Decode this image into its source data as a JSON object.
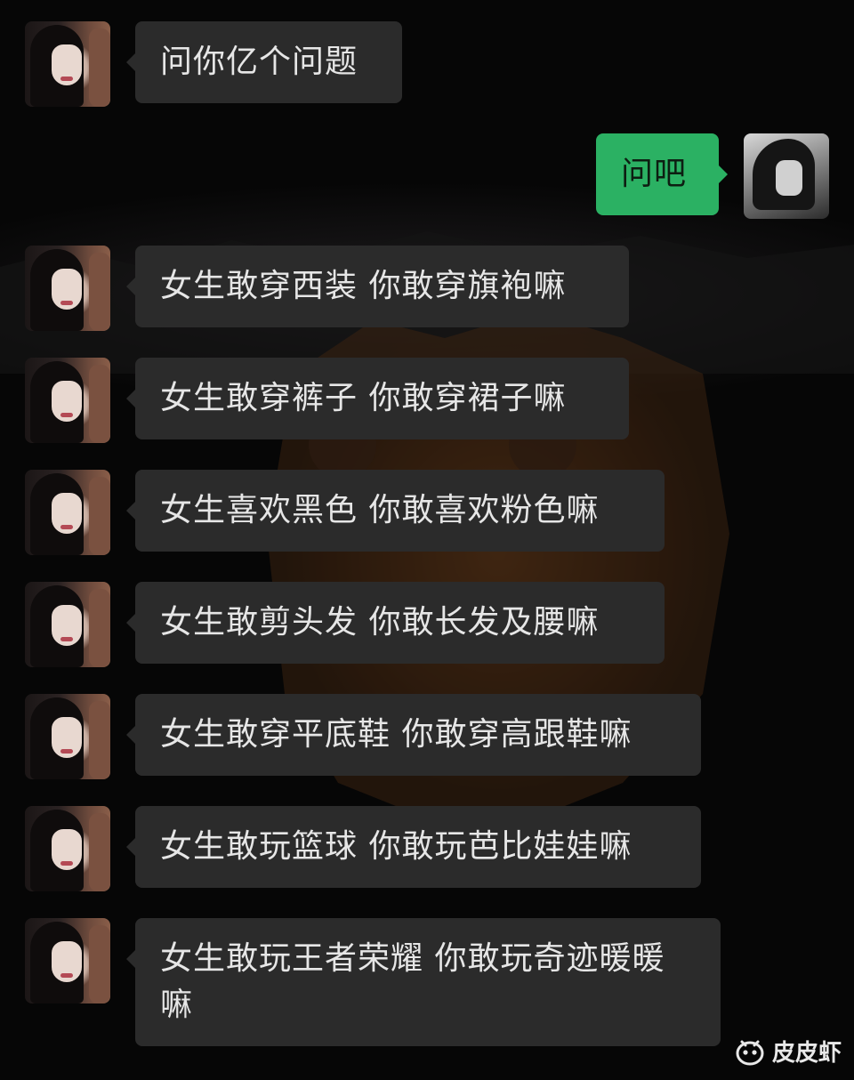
{
  "chat": {
    "messages": [
      {
        "side": "in",
        "text": "问你亿个问题"
      },
      {
        "side": "out",
        "text": "问吧"
      },
      {
        "side": "in",
        "text": "女生敢穿西装 你敢穿旗袍嘛"
      },
      {
        "side": "in",
        "text": "女生敢穿裤子 你敢穿裙子嘛"
      },
      {
        "side": "in",
        "text": "女生喜欢黑色 你敢喜欢粉色嘛"
      },
      {
        "side": "in",
        "text": "女生敢剪头发 你敢长发及腰嘛"
      },
      {
        "side": "in",
        "text": "女生敢穿平底鞋 你敢穿高跟鞋嘛"
      },
      {
        "side": "in",
        "text": "女生敢玩篮球 你敢玩芭比娃娃嘛"
      },
      {
        "side": "in",
        "text": "女生敢玩王者荣耀 你敢玩奇迹暖暖嘛"
      }
    ]
  },
  "watermark": {
    "label": "皮皮虾",
    "icon": "pipixia-logo-icon"
  },
  "colors": {
    "incoming_bubble": "#2b2b2b",
    "outgoing_bubble": "#2bb163",
    "incoming_text": "#e6e6e6",
    "outgoing_text": "#0d1e12",
    "background": "#060606"
  }
}
